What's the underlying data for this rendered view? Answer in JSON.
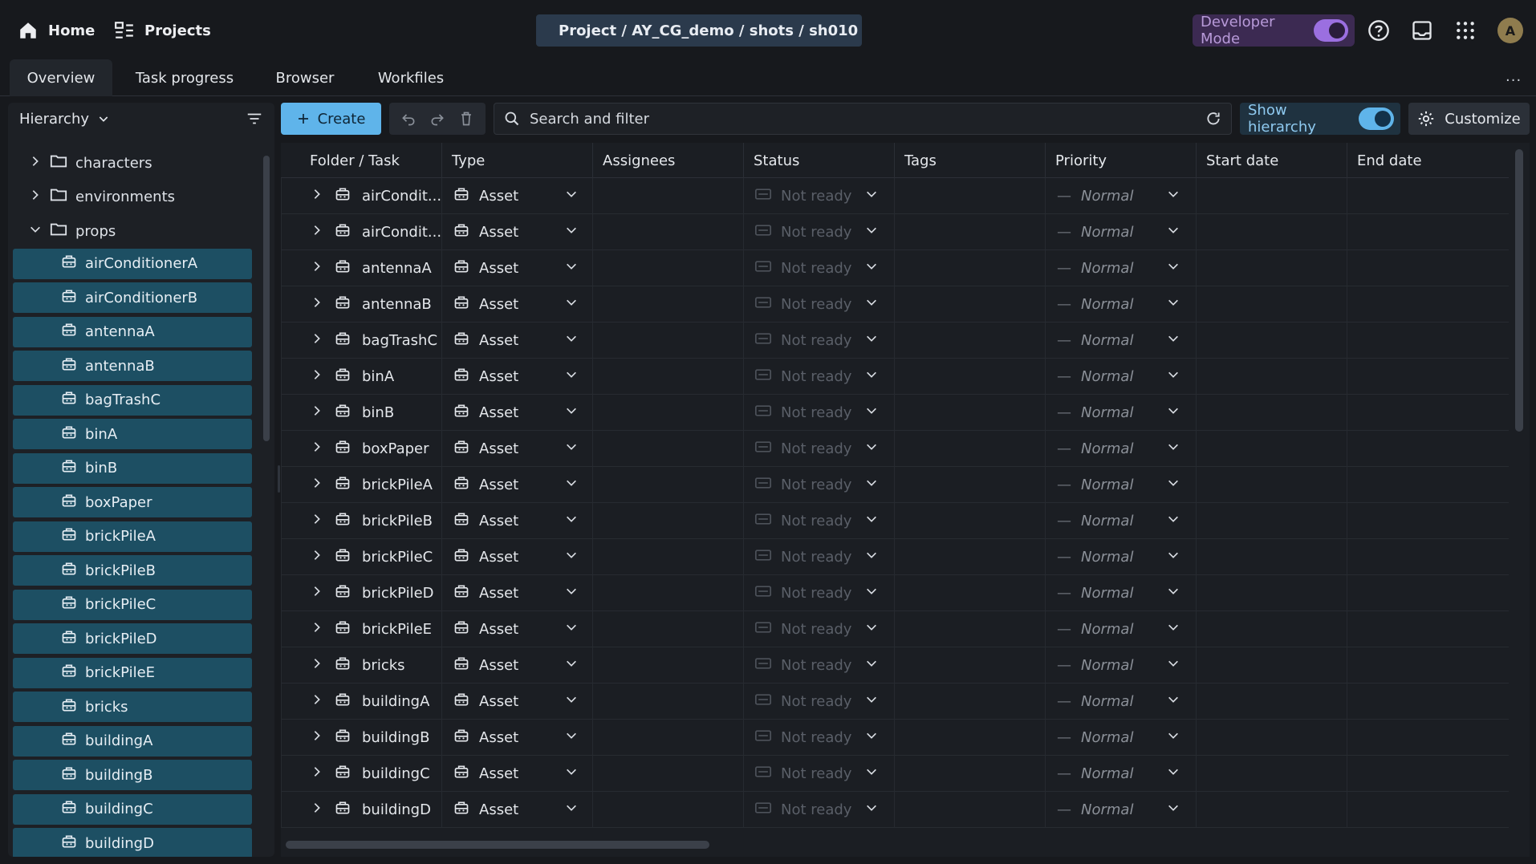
{
  "topbar": {
    "home_label": "Home",
    "projects_label": "Projects",
    "breadcrumb": "Project / AY_CG_demo / shots / sh010",
    "developer_mode_label": "Developer Mode",
    "developer_mode_on": true,
    "avatar_initial": "A",
    "icons": [
      "home-icon",
      "projects-icon",
      "edit-icon",
      "copy-icon",
      "help-icon",
      "inbox-icon",
      "apps-grid-icon"
    ]
  },
  "tabs": [
    {
      "label": "Overview",
      "active": true
    },
    {
      "label": "Task progress",
      "active": false
    },
    {
      "label": "Browser",
      "active": false
    },
    {
      "label": "Workfiles",
      "active": false
    }
  ],
  "sidebar": {
    "header_label": "Hierarchy",
    "folders": [
      {
        "label": "characters",
        "expanded": false
      },
      {
        "label": "environments",
        "expanded": false
      },
      {
        "label": "props",
        "expanded": true
      }
    ],
    "assets": [
      "airConditionerA",
      "airConditionerB",
      "antennaA",
      "antennaB",
      "bagTrashC",
      "binA",
      "binB",
      "boxPaper",
      "brickPileA",
      "brickPileB",
      "brickPileC",
      "brickPileD",
      "brickPileE",
      "bricks",
      "buildingA",
      "buildingB",
      "buildingC",
      "buildingD"
    ]
  },
  "toolbar": {
    "create_label": "Create",
    "search_placeholder": "Search and filter",
    "show_hierarchy_label": "Show hierarchy",
    "show_hierarchy_on": true,
    "customize_label": "Customize"
  },
  "grid": {
    "columns": [
      "Folder / Task",
      "Type",
      "Assignees",
      "Status",
      "Tags",
      "Priority",
      "Start date",
      "End date"
    ],
    "rows": [
      {
        "name": "airCondit...",
        "type": "Asset",
        "status": "Not ready",
        "priority": "Normal"
      },
      {
        "name": "airCondit...",
        "type": "Asset",
        "status": "Not ready",
        "priority": "Normal"
      },
      {
        "name": "antennaA",
        "type": "Asset",
        "status": "Not ready",
        "priority": "Normal"
      },
      {
        "name": "antennaB",
        "type": "Asset",
        "status": "Not ready",
        "priority": "Normal"
      },
      {
        "name": "bagTrashC",
        "type": "Asset",
        "status": "Not ready",
        "priority": "Normal"
      },
      {
        "name": "binA",
        "type": "Asset",
        "status": "Not ready",
        "priority": "Normal"
      },
      {
        "name": "binB",
        "type": "Asset",
        "status": "Not ready",
        "priority": "Normal"
      },
      {
        "name": "boxPaper",
        "type": "Asset",
        "status": "Not ready",
        "priority": "Normal"
      },
      {
        "name": "brickPileA",
        "type": "Asset",
        "status": "Not ready",
        "priority": "Normal"
      },
      {
        "name": "brickPileB",
        "type": "Asset",
        "status": "Not ready",
        "priority": "Normal"
      },
      {
        "name": "brickPileC",
        "type": "Asset",
        "status": "Not ready",
        "priority": "Normal"
      },
      {
        "name": "brickPileD",
        "type": "Asset",
        "status": "Not ready",
        "priority": "Normal"
      },
      {
        "name": "brickPileE",
        "type": "Asset",
        "status": "Not ready",
        "priority": "Normal"
      },
      {
        "name": "bricks",
        "type": "Asset",
        "status": "Not ready",
        "priority": "Normal"
      },
      {
        "name": "buildingA",
        "type": "Asset",
        "status": "Not ready",
        "priority": "Normal"
      },
      {
        "name": "buildingB",
        "type": "Asset",
        "status": "Not ready",
        "priority": "Normal"
      },
      {
        "name": "buildingC",
        "type": "Asset",
        "status": "Not ready",
        "priority": "Normal"
      },
      {
        "name": "buildingD",
        "type": "Asset",
        "status": "Not ready",
        "priority": "Normal"
      }
    ]
  },
  "colors": {
    "background": "#17191d",
    "accent_blue": "#5fb4ea",
    "selected_row": "#1d4f63",
    "developer_purple": "#9b6fe0",
    "status_muted": "#5a5f68"
  }
}
